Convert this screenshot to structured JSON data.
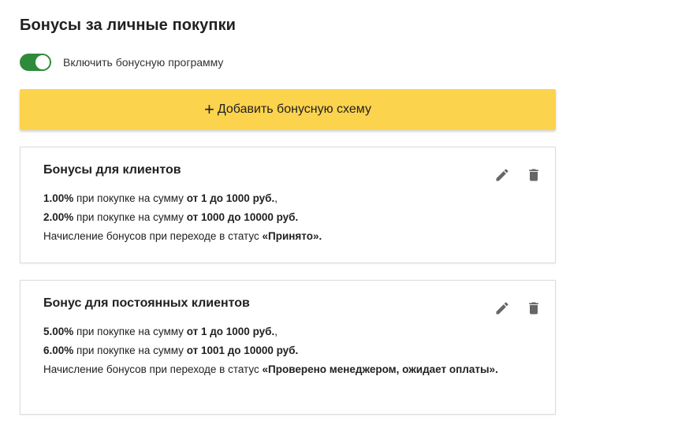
{
  "header": {
    "title": "Бонусы за личные покупки"
  },
  "toggle": {
    "label": "Включить бонусную программу",
    "enabled": true,
    "accent": "#2e8b3a"
  },
  "add_button": {
    "plus": "+",
    "label": "Добавить бонусную схему",
    "color": "#fcd34d"
  },
  "schemes": [
    {
      "title": "Бонусы для клиентов",
      "tiers": [
        {
          "percent": "1.00%",
          "text": " при покупке на сумму ",
          "range": "от 1 до 1000 руб.",
          "end": ","
        },
        {
          "percent": "2.00%",
          "text": " при покупке на сумму ",
          "range": "от 1000 до 10000 руб.",
          "end": ""
        }
      ],
      "status_prefix": "Начисление бонусов при переходе в статус ",
      "status": "«Принято»",
      "status_suffix": "."
    },
    {
      "title": "Бонус для постоянных клиентов",
      "tiers": [
        {
          "percent": "5.00%",
          "text": " при покупке на сумму ",
          "range": "от 1 до 1000 руб.",
          "end": ","
        },
        {
          "percent": "6.00%",
          "text": " при покупке на сумму ",
          "range": "от 1001 до 10000 руб.",
          "end": ""
        }
      ],
      "status_prefix": "Начисление бонусов при переходе в статус ",
      "status": "«Проверено менеджером, ожидает оплаты»",
      "status_suffix": "."
    }
  ],
  "icons": {
    "edit": "pencil-icon",
    "delete": "trash-icon"
  }
}
